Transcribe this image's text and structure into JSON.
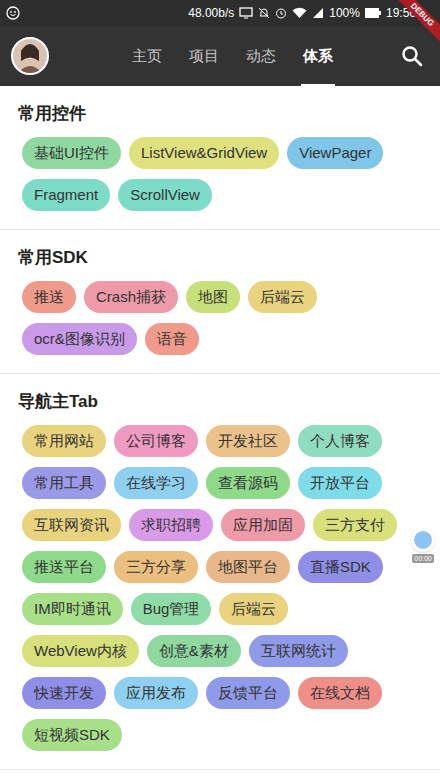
{
  "status_bar": {
    "speed": "48.00b/s",
    "battery": "100%",
    "time": "19:56",
    "debug_banner": "DEBUG"
  },
  "tabs": [
    {
      "label": "主页",
      "selected": false
    },
    {
      "label": "项目",
      "selected": false
    },
    {
      "label": "动态",
      "selected": false
    },
    {
      "label": "体系",
      "selected": true
    }
  ],
  "sections": [
    {
      "title": "常用控件",
      "chips": [
        {
          "label": "基础UI控件",
          "color": "#8fd9a0"
        },
        {
          "label": "ListView&GridView",
          "color": "#dfe07e"
        },
        {
          "label": "ViewPager",
          "color": "#80c6e8"
        },
        {
          "label": "Fragment",
          "color": "#7ddcc8"
        },
        {
          "label": "ScrollView",
          "color": "#7ddcc8"
        }
      ]
    },
    {
      "title": "常用SDK",
      "chips": [
        {
          "label": "推送",
          "color": "#ef9a8a"
        },
        {
          "label": "Crash捕获",
          "color": "#ef9aa8"
        },
        {
          "label": "地图",
          "color": "#c7e07a"
        },
        {
          "label": "后端云",
          "color": "#ead37e"
        },
        {
          "label": "ocr&图像识别",
          "color": "#c99ae8"
        },
        {
          "label": "语音",
          "color": "#ef9a8a"
        }
      ]
    },
    {
      "title": "导航主Tab",
      "chips": [
        {
          "label": "常用网站",
          "color": "#ead37e"
        },
        {
          "label": "公司博客",
          "color": "#ef9ac0"
        },
        {
          "label": "开发社区",
          "color": "#eac28a"
        },
        {
          "label": "个人博客",
          "color": "#8fdcc0"
        },
        {
          "label": "常用工具",
          "color": "#9a9ae8"
        },
        {
          "label": "在线学习",
          "color": "#8fd0f0"
        },
        {
          "label": "查看源码",
          "color": "#8fd98a"
        },
        {
          "label": "开放平台",
          "color": "#7edce8"
        },
        {
          "label": "互联网资讯",
          "color": "#ead37e"
        },
        {
          "label": "求职招聘",
          "color": "#d99ae8"
        },
        {
          "label": "应用加固",
          "color": "#ef9aa8"
        },
        {
          "label": "三方支付",
          "color": "#d7e07a"
        },
        {
          "label": "推送平台",
          "color": "#8fd98a"
        },
        {
          "label": "三方分享",
          "color": "#ebbf7e"
        },
        {
          "label": "地图平台",
          "color": "#e8b88a"
        },
        {
          "label": "直播SDK",
          "color": "#8f8fe8"
        },
        {
          "label": "IM即时通讯",
          "color": "#a8e08a"
        },
        {
          "label": "Bug管理",
          "color": "#8fdca8"
        },
        {
          "label": "后端云",
          "color": "#ead37e"
        },
        {
          "label": "WebView内核",
          "color": "#d7e07a"
        },
        {
          "label": "创意&素材",
          "color": "#8fd9a0"
        },
        {
          "label": "互联网统计",
          "color": "#8f9ae8"
        },
        {
          "label": "快速开发",
          "color": "#8f8fe8"
        },
        {
          "label": "应用发布",
          "color": "#8fd0f0"
        },
        {
          "label": "反馈平台",
          "color": "#8f9ae8"
        },
        {
          "label": "在线文档",
          "color": "#ef8f8a"
        },
        {
          "label": "短视频SDK",
          "color": "#a8e08a"
        }
      ]
    }
  ],
  "overlay": {
    "timer": "00:00"
  }
}
